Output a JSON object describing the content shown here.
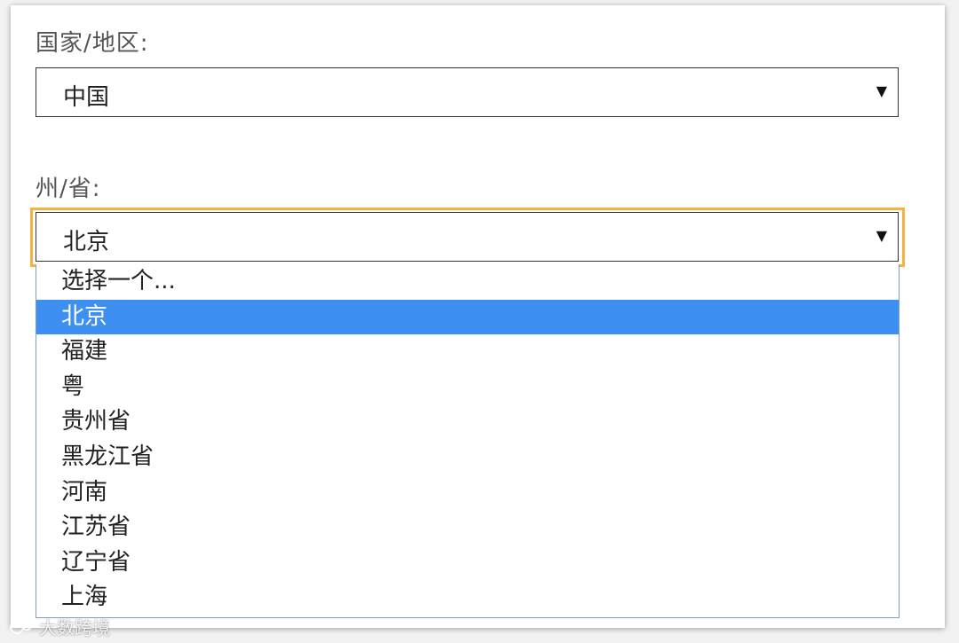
{
  "country": {
    "label": "国家/地区:",
    "value": "中国"
  },
  "state": {
    "label": "州/省:",
    "value": "北京",
    "options": [
      {
        "label": "选择一个...",
        "selected": false
      },
      {
        "label": "北京",
        "selected": true
      },
      {
        "label": "福建",
        "selected": false
      },
      {
        "label": "粤",
        "selected": false
      },
      {
        "label": "贵州省",
        "selected": false
      },
      {
        "label": "黑龙江省",
        "selected": false
      },
      {
        "label": "河南",
        "selected": false
      },
      {
        "label": "江苏省",
        "selected": false
      },
      {
        "label": "辽宁省",
        "selected": false
      },
      {
        "label": "上海",
        "selected": false
      }
    ]
  },
  "icons": {
    "dropdown_arrow": "▼"
  },
  "colors": {
    "focus_ring": "#f1b642",
    "selected_option": "#3d8ff1"
  },
  "watermark": {
    "text": "大数跨境",
    "logo": "watermark-logo-icon"
  }
}
